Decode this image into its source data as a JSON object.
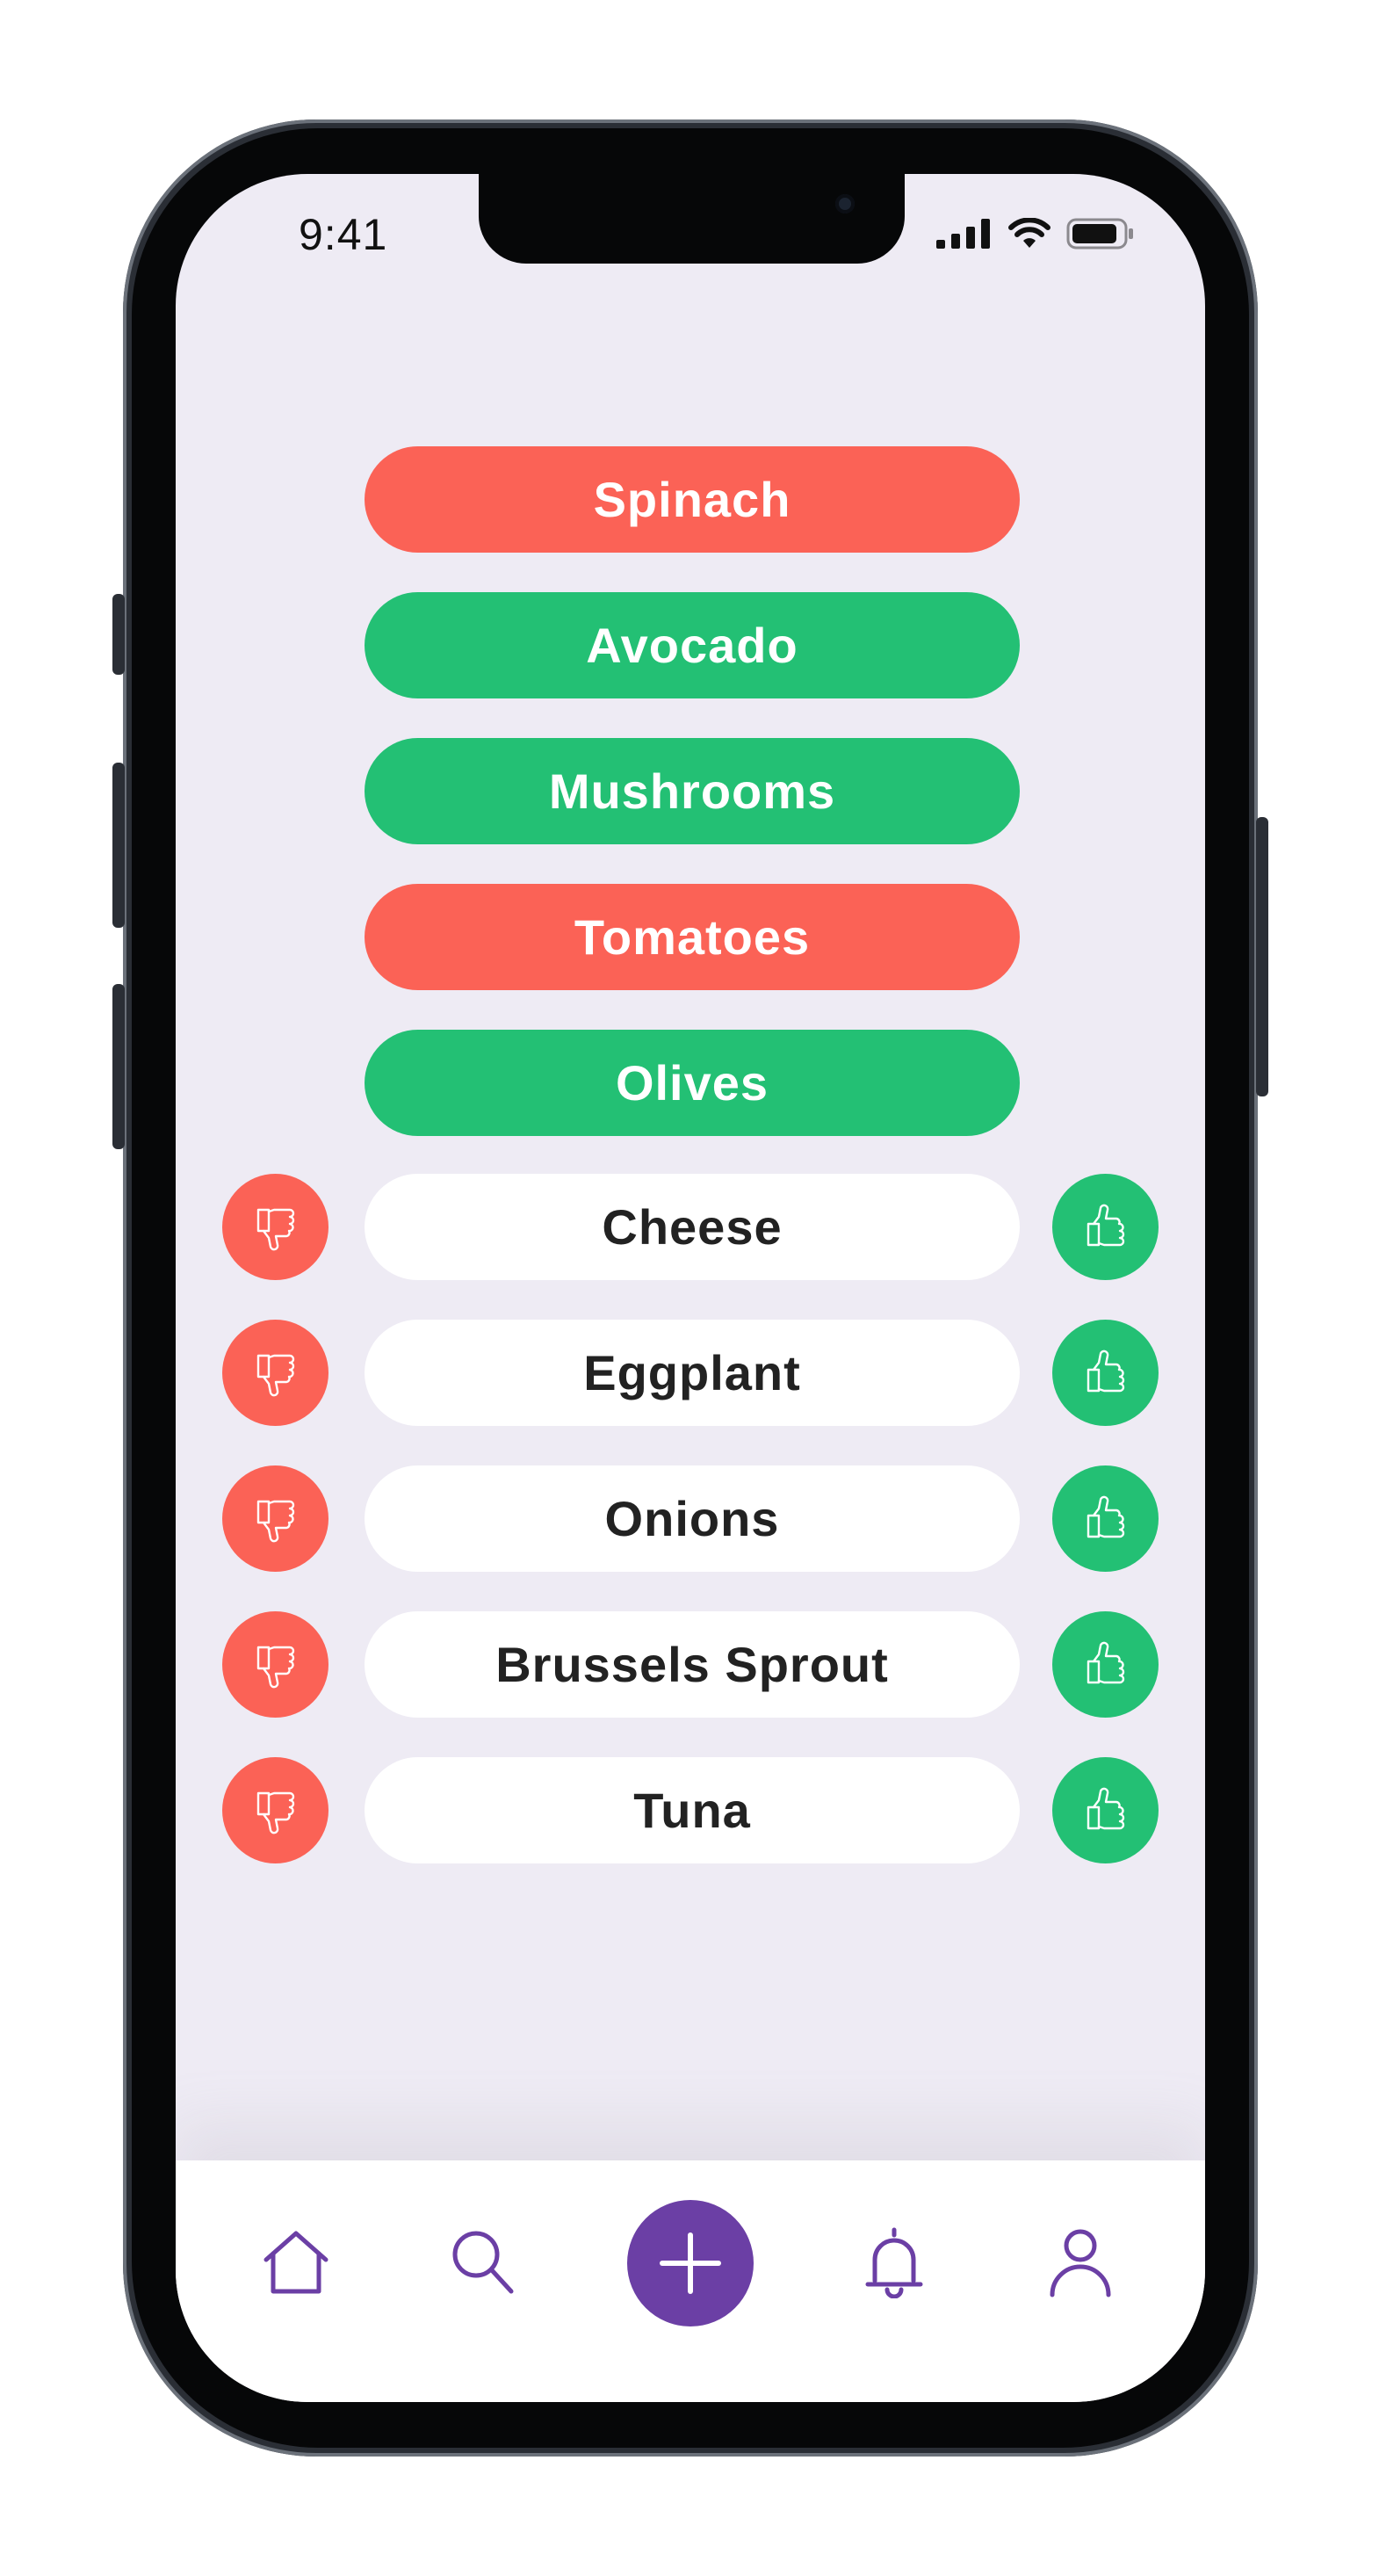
{
  "status_bar": {
    "time": "9:41"
  },
  "colors": {
    "dislike": "#fb6256",
    "like": "#23c074",
    "accent": "#6b3fa5",
    "screen_bg": "#eeebf4"
  },
  "rated_items": [
    {
      "label": "Spinach",
      "rating": "disliked"
    },
    {
      "label": "Avocado",
      "rating": "liked"
    },
    {
      "label": "Mushrooms",
      "rating": "liked"
    },
    {
      "label": "Tomatoes",
      "rating": "disliked"
    },
    {
      "label": "Olives",
      "rating": "liked"
    }
  ],
  "unrated_items": [
    {
      "label": "Cheese"
    },
    {
      "label": "Eggplant"
    },
    {
      "label": "Onions"
    },
    {
      "label": "Brussels Sprout"
    },
    {
      "label": "Tuna"
    }
  ],
  "vote_icons": {
    "down": "thumbs-down-icon",
    "up": "thumbs-up-icon"
  },
  "tab_bar": {
    "items": [
      {
        "icon": "home-icon"
      },
      {
        "icon": "search-icon"
      },
      {
        "icon": "plus-icon"
      },
      {
        "icon": "bell-icon"
      },
      {
        "icon": "user-icon"
      }
    ]
  }
}
